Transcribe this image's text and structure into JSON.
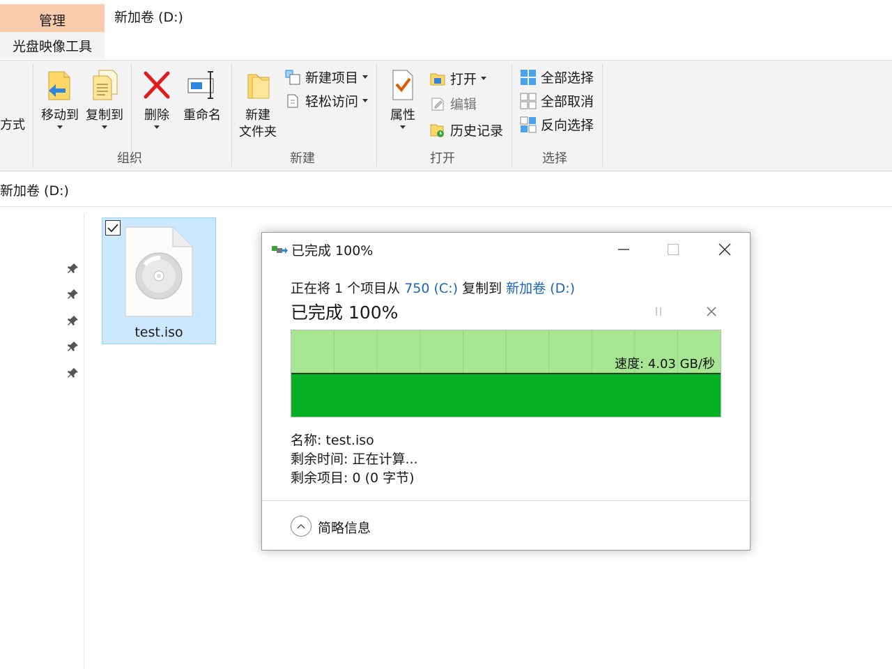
{
  "ribbon": {
    "ctx_tab_manage": "管理",
    "ctx_tab_tool": "光盘映像工具",
    "window_title": "新加卷 (D:)",
    "cut_off_label": "方式",
    "organize": {
      "move_to": "移动到",
      "copy_to": "复制到",
      "delete": "删除",
      "rename": "重命名",
      "group": "组织"
    },
    "new": {
      "new_folder_line1": "新建",
      "new_folder_line2": "文件夹",
      "new_item": "新建项目",
      "easy_access": "轻松访问",
      "group": "新建"
    },
    "open": {
      "properties": "属性",
      "open": "打开",
      "edit": "编辑",
      "history": "历史记录",
      "group": "打开"
    },
    "select": {
      "select_all": "全部选择",
      "select_none": "全部取消",
      "invert": "反向选择",
      "group": "选择"
    }
  },
  "address": {
    "path": "新加卷 (D:)"
  },
  "file": {
    "name": "test.iso",
    "checked": true
  },
  "dialog": {
    "title": "已完成 100%",
    "copy_prefix": "正在将 1 个项目从",
    "source": "750 (C:)",
    "copy_mid": "复制到",
    "dest": "新加卷 (D:)",
    "status": "已完成 100%",
    "progress_percent": 100,
    "speed": "速度: 4.03 GB/秒",
    "name_line": "名称:  test.iso",
    "time_line": "剩余时间:  正在计算...",
    "items_line": "剩余项目:  0 (0 字节)",
    "details_toggle": "简略信息",
    "colors": {
      "fill_light": "#a6e591",
      "fill_dark": "#06b025",
      "link": "#1b65b8"
    }
  }
}
